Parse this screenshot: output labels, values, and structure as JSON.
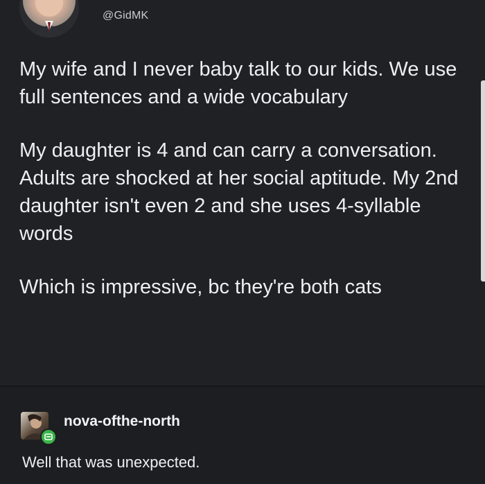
{
  "tweet": {
    "handle": "@GidMK",
    "paragraphs": [
      "My wife and I never baby talk to our kids. We use full sentences and a wide vocabulary",
      "My daughter is 4 and can carry a conversation. Adults are shocked at her social aptitude. My 2nd daughter isn't even 2 and she uses 4-syllable words",
      "Which is impressive, bc they're both cats"
    ]
  },
  "reply": {
    "username": "nova-ofthe-north",
    "text": "Well that was unexpected."
  },
  "colors": {
    "background": "#202124",
    "text": "#eeeff1",
    "badge": "#3ab54a"
  }
}
